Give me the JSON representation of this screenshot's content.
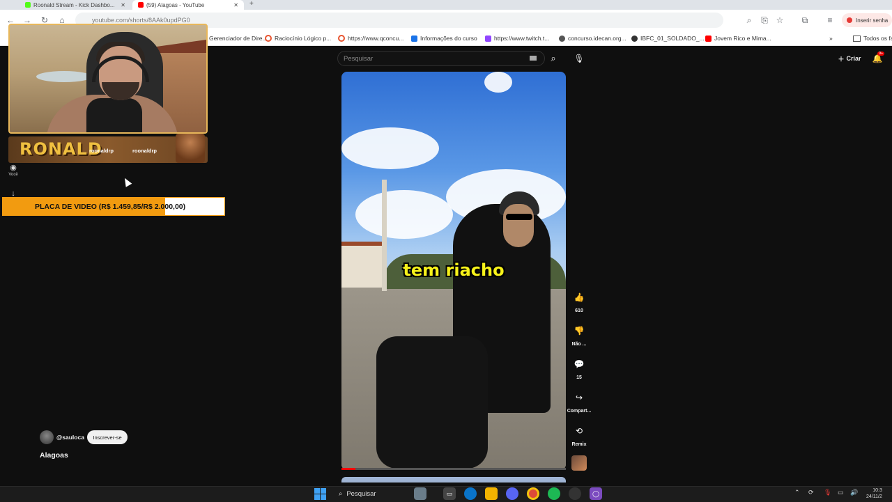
{
  "browser": {
    "tabs": [
      {
        "label": "Roonald Stream - Kick Dashbo...",
        "color": "#53fc18"
      },
      {
        "label": "(59) Alagoas - YouTube",
        "color": "#ff0000"
      }
    ],
    "url": "youtube.com/shorts/8AAk0updPG0",
    "sign_in_label": "Inserir senha",
    "bookmarks": [
      {
        "label": "Gerenciador de Dire...",
        "color": "#4285f4"
      },
      {
        "label": "Raciocínio Lógico p...",
        "color": "#e8542f"
      },
      {
        "label": "https://www.qconcu...",
        "color": "#e8542f"
      },
      {
        "label": "Informações do curso",
        "color": "#1a73e8"
      },
      {
        "label": "https://www.twitch.t...",
        "color": "#9146ff"
      },
      {
        "label": "concurso.idecan.org...",
        "color": "#555555"
      },
      {
        "label": "IBFC_01_SOLDADO_...",
        "color": "#333333"
      },
      {
        "label": "Jovem Rico e Mima...",
        "color": "#ff0000"
      }
    ],
    "all_bookmarks_label": "Todos os fa"
  },
  "stream_overlay": {
    "name": "RONALD",
    "handle_1": "roonaldrp",
    "handle_2": "roonaldrp",
    "goal_text": "PLACA DE VIDEO (R$ 1.459,85/R$ 2.000,00)",
    "goal_progress": 0.73,
    "goal_color": "#f29b10"
  },
  "youtube": {
    "side_you_label": "Você",
    "search_placeholder": "Pesquisar",
    "create_label": "Criar",
    "notif_badge": "9+",
    "caption": "tem riacho",
    "actions": {
      "likes": "610",
      "dislike": "Não ...",
      "comments": "15",
      "share": "Compart...",
      "remix": "Remix"
    },
    "channel": "@sauloca",
    "subscribe_label": "Inscrever-se",
    "title": "Alagoas"
  },
  "taskbar": {
    "search_label": "Pesquisar",
    "time": "10:3",
    "date": "24/11/2"
  }
}
